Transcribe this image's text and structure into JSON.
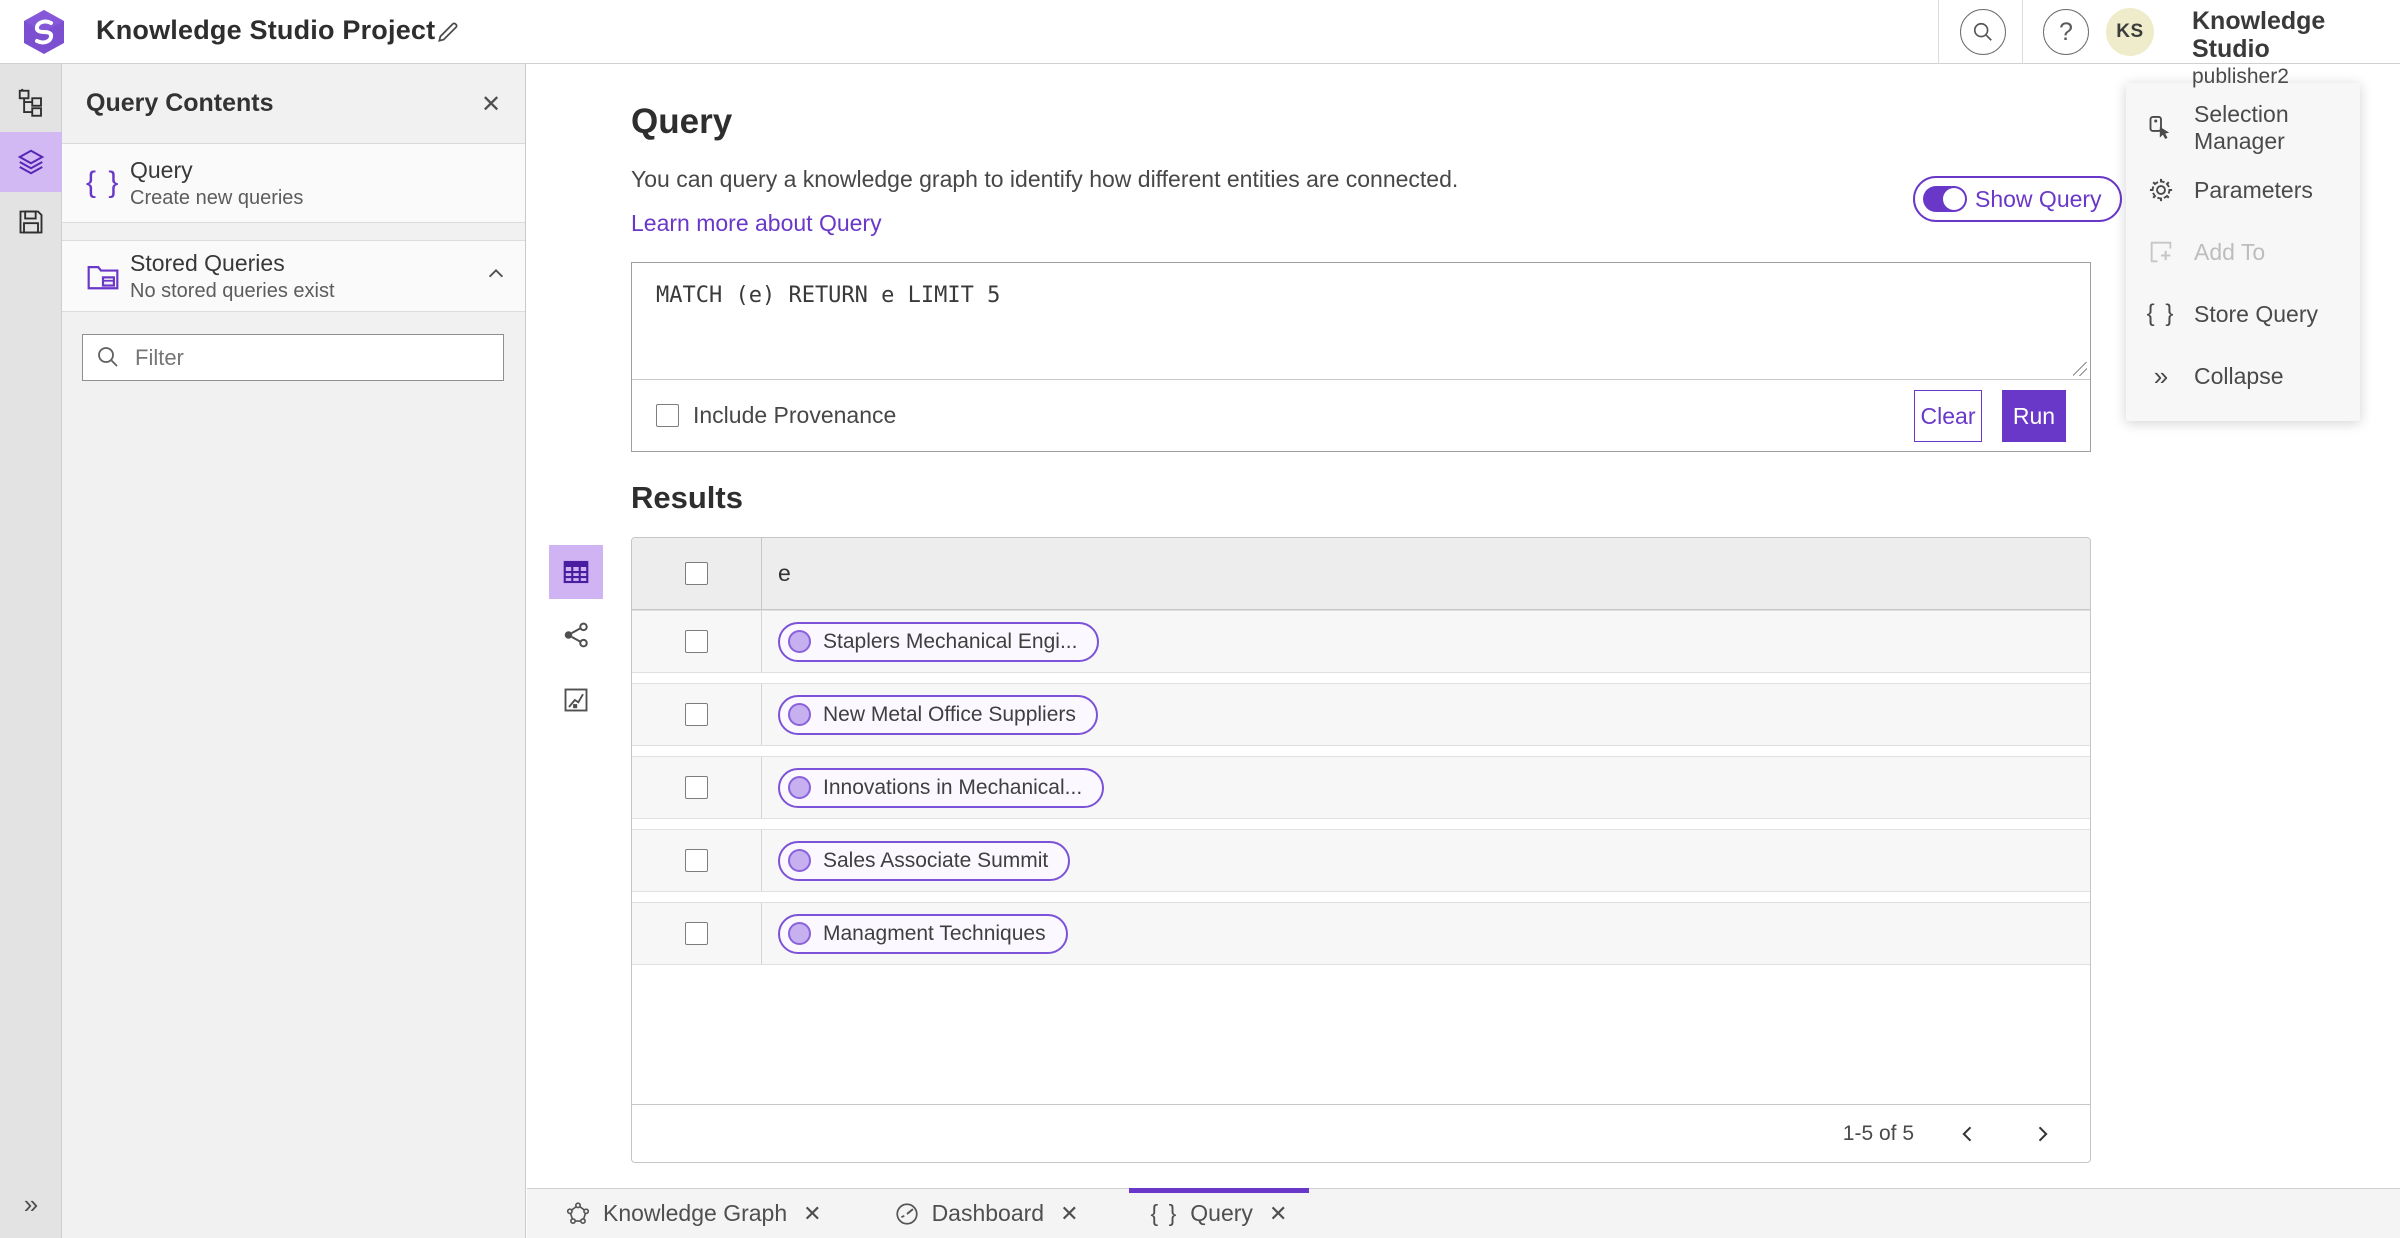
{
  "topbar": {
    "title": "Knowledge Studio Project",
    "app_name": "Knowledge Studio",
    "user_name": "publisher2",
    "avatar_initials": "KS",
    "help_glyph": "?"
  },
  "panel": {
    "title": "Query Contents",
    "close_glyph": "✕",
    "query_item": {
      "title": "Query",
      "subtitle": "Create new queries",
      "icon_glyph": "{ }"
    },
    "stored_item": {
      "title": "Stored Queries",
      "subtitle": "No stored queries exist"
    },
    "filter_placeholder": "Filter"
  },
  "query": {
    "heading": "Query",
    "description": "You can query a knowledge graph to identify how different entities are connected.",
    "learn_more": "Learn more about Query",
    "show_query_label": "Show Query",
    "text": "MATCH (e) RETURN e LIMIT 5",
    "include_provenance_label": "Include Provenance",
    "clear_label": "Clear",
    "run_label": "Run"
  },
  "results": {
    "heading": "Results",
    "column_label": "e",
    "rows": [
      {
        "label": "Staplers Mechanical Engi..."
      },
      {
        "label": "New Metal Office Suppliers"
      },
      {
        "label": "Innovations in Mechanical..."
      },
      {
        "label": "Sales Associate Summit"
      },
      {
        "label": "Managment Techniques"
      }
    ],
    "pagination_label": "1-5 of 5"
  },
  "context_menu": {
    "selection_manager": "Selection Manager",
    "parameters": "Parameters",
    "add_to": "Add To",
    "store_query": "Store Query",
    "store_query_glyph": "{ }",
    "collapse": "Collapse",
    "collapse_glyph": "»"
  },
  "rail": {
    "expand_glyph": "»"
  },
  "tabs": [
    {
      "label": "Knowledge Graph"
    },
    {
      "label": "Dashboard"
    },
    {
      "label": "Query",
      "icon_glyph": "{ }"
    }
  ],
  "colors": {
    "accent": "#6a38c8",
    "accent_light": "#d2b9f4",
    "avatar_bg": "#eeeccb",
    "chip_border": "#7c52d9",
    "chip_dot": "#c7b0ef"
  }
}
